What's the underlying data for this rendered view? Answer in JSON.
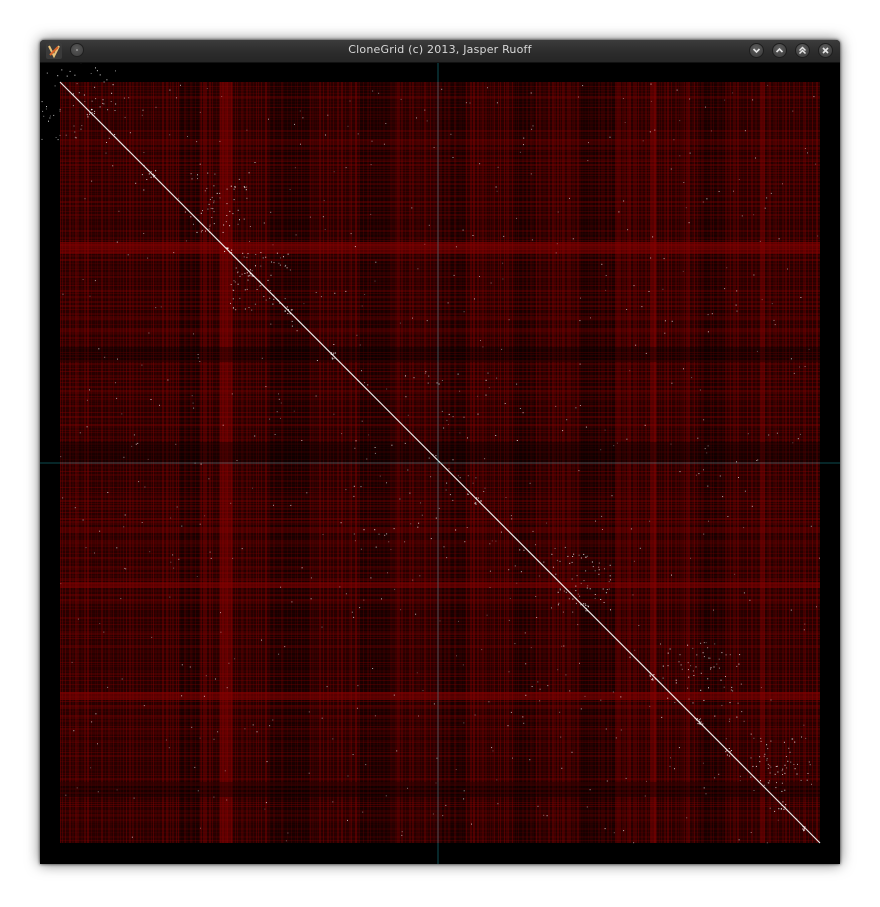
{
  "window": {
    "title": "CloneGrid (c) 2013, Jasper Ruoff",
    "icon": "clonegrid-app-icon",
    "buttons": [
      {
        "name": "minimize-button",
        "icon": "chevron-down-icon"
      },
      {
        "name": "maximize-button",
        "icon": "chevron-up-icon"
      },
      {
        "name": "keep-above-button",
        "icon": "double-chevron-up-icon"
      },
      {
        "name": "close-button",
        "icon": "close-icon"
      }
    ]
  },
  "grid": {
    "background_color": "#000000",
    "cell_color": "#8b0000",
    "diagonal_color": "#ffffff",
    "crosshair_color": "#1fa7b5"
  }
}
